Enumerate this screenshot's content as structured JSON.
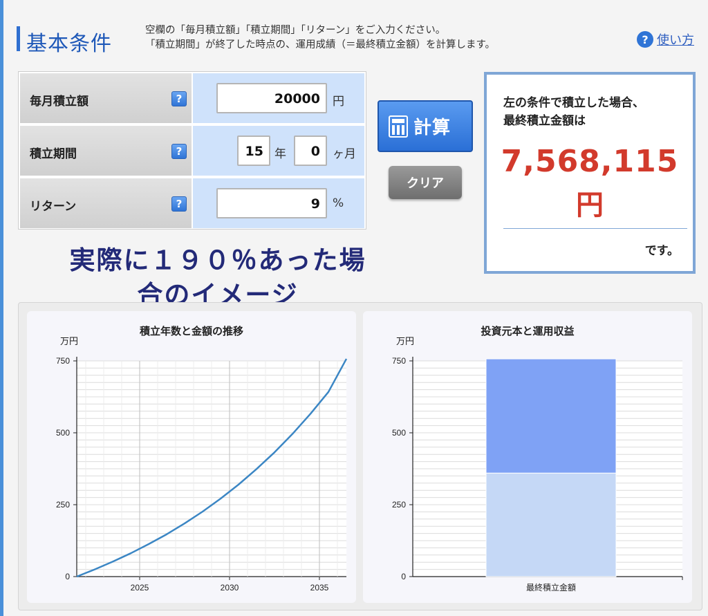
{
  "header": {
    "title": "基本条件",
    "desc_line1": "空欄の「毎月積立額」「積立期間」「リターン」をご入力ください。",
    "desc_line2": "「積立期間」が終了した時点の、運用成績（＝最終積立金額）を計算します。",
    "help_label": "使い方",
    "help_icon": "?"
  },
  "form": {
    "monthly": {
      "label": "毎月積立額",
      "value": "20000",
      "unit": "円"
    },
    "period": {
      "label": "積立期間",
      "years": "15",
      "year_unit": "年",
      "months": "0",
      "month_unit": "ヶ月"
    },
    "return": {
      "label": "リターン",
      "value": "9",
      "unit": "%"
    },
    "help_icon": "?"
  },
  "buttons": {
    "calc": "計算",
    "clear": "クリア"
  },
  "result": {
    "line1": "左の条件で積立した場合、",
    "line2": "最終積立金額は",
    "amount": "7,568,115",
    "unit": "円",
    "suffix": "です。"
  },
  "overlay": {
    "line1": "実際に１９０％あった場",
    "line2": "合のイメージ"
  },
  "colors": {
    "line": "#3b86c4",
    "bar_top": "#7fa2f5",
    "bar_bottom": "#c5d8f6"
  },
  "chart_data": [
    {
      "type": "line",
      "title": "積立年数と金額の推移",
      "ylabel": "万円",
      "xlim": [
        2021.5,
        2036.5
      ],
      "ylim": [
        0,
        750
      ],
      "xticks": [
        "2025",
        "2030",
        "2035"
      ],
      "xtick_values": [
        2025,
        2030,
        2035
      ],
      "yticks": [
        "0",
        "250",
        "500",
        "750"
      ],
      "ytick_values": [
        0,
        250,
        500,
        750
      ],
      "series": [
        {
          "x": [
            2021.5,
            2022.5,
            2023.5,
            2024.5,
            2025.5,
            2026.5,
            2027.5,
            2028.5,
            2029.5,
            2030.5,
            2031.5,
            2032.5,
            2033.5,
            2034.5,
            2035.5,
            2036.5
          ],
          "values": [
            0,
            25,
            52,
            81,
            113,
            147,
            185,
            226,
            271,
            320,
            374,
            432,
            496,
            566,
            642,
            757
          ]
        }
      ]
    },
    {
      "type": "bar",
      "title": "投資元本と運用収益",
      "ylabel": "万円",
      "categories": [
        "最終積立金額"
      ],
      "ylim": [
        0,
        750
      ],
      "yticks": [
        "0",
        "250",
        "500",
        "750"
      ],
      "ytick_values": [
        0,
        250,
        500,
        750
      ],
      "stacked": true,
      "series": [
        {
          "values": [
            360
          ]
        },
        {
          "values": [
            397
          ]
        }
      ]
    }
  ]
}
